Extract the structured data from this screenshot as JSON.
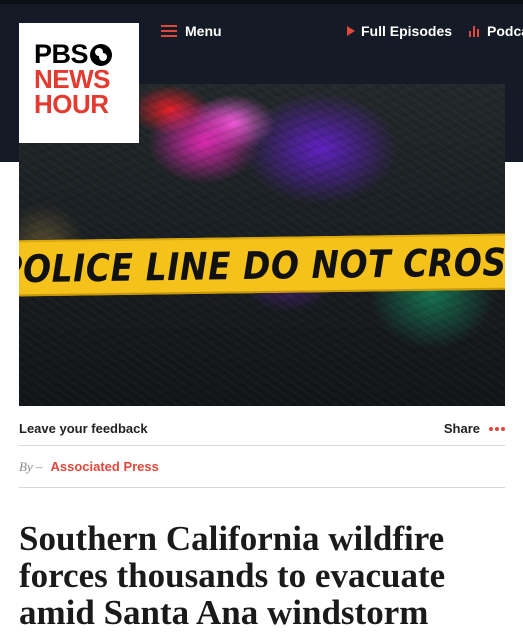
{
  "header": {
    "logo": {
      "line1": "PBS",
      "line2": "NEWS",
      "line3": "HOUR"
    },
    "nav": {
      "menu_label": "Menu",
      "episodes_label": "Full Episodes",
      "podcasts_label": "Podcasts"
    },
    "colors": {
      "bar": "#141b26",
      "accent": "#e0483b"
    }
  },
  "hero": {
    "tape_text": "POLICE LINE DO NOT CROSS"
  },
  "article_meta": {
    "feedback_label": "Leave your feedback",
    "share_label": "Share",
    "by_prefix": "By –",
    "author": "Associated Press"
  },
  "headline": "Southern California wildfire forces thousands to evacuate amid Santa Ana windstorm"
}
